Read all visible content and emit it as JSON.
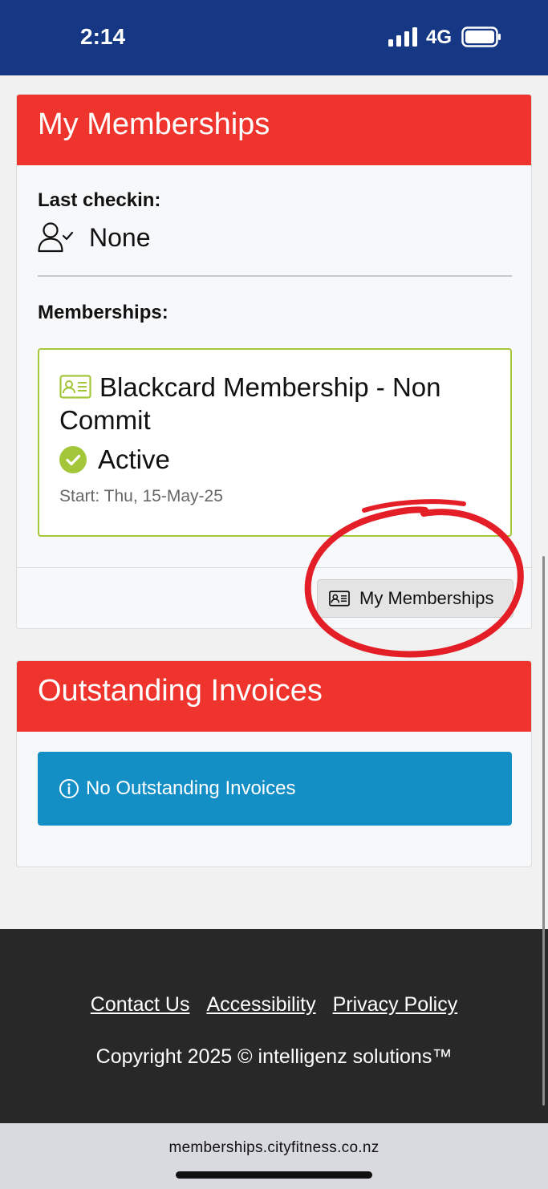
{
  "status_bar": {
    "time": "2:14",
    "network": "4G"
  },
  "memberships_card": {
    "title": "My Memberships",
    "last_checkin_label": "Last checkin:",
    "last_checkin_value": "None",
    "memberships_label": "Memberships:",
    "membership": {
      "name": "Blackcard Membership - Non Commit",
      "status": "Active",
      "start": "Start: Thu, 15-May-25"
    },
    "button_label": "My Memberships"
  },
  "invoices_card": {
    "title": "Outstanding Invoices",
    "alert_text": "No Outstanding Invoices"
  },
  "footer": {
    "links": [
      "Contact Us",
      "Accessibility",
      "Privacy Policy"
    ],
    "copyright": "Copyright 2025 © intelligenz solutions™"
  },
  "browser": {
    "url": "memberships.cityfitness.co.nz"
  },
  "colors": {
    "status_bar": "#163884",
    "header_red": "#ee342c",
    "accent_green": "#a4c639",
    "info_blue": "#138fc6",
    "footer_bg": "#282828",
    "annotation_red": "#e41e26"
  },
  "icons": {
    "checkin": "user-check-icon",
    "membership": "id-card-icon",
    "status": "check-circle-icon",
    "alert": "info-icon"
  }
}
